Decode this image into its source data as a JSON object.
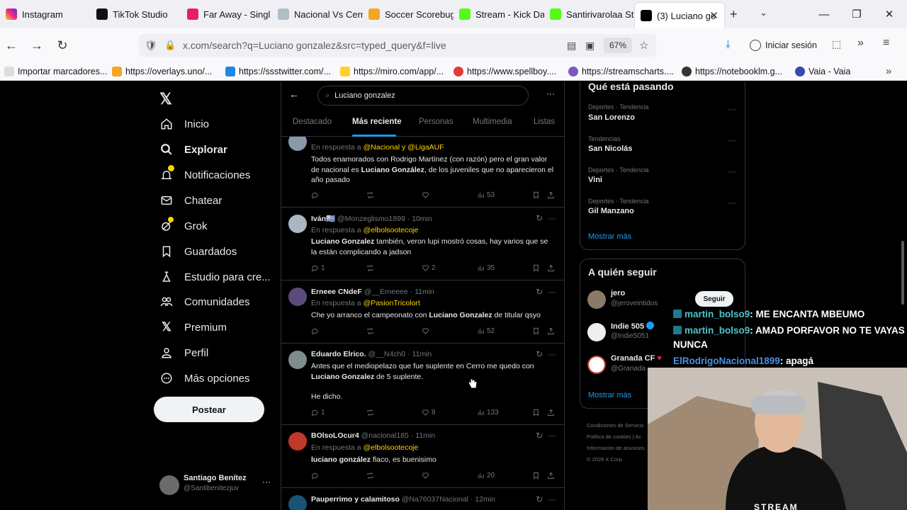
{
  "browser": {
    "tabs": [
      {
        "title": "Instagram",
        "color": "#d62976"
      },
      {
        "title": "TikTok Studio",
        "color": "#000000"
      },
      {
        "title": "Far Away - Singl",
        "color": "#e91e63"
      },
      {
        "title": "Nacional Vs Cerr",
        "color": "#b0bec5"
      },
      {
        "title": "Soccer Scorebug",
        "color": "#f5a623"
      },
      {
        "title": "Stream - Kick Da",
        "color": "#53fc18"
      },
      {
        "title": "Santirivarolaa St",
        "color": "#53fc18"
      },
      {
        "title": "(3) Luciano go",
        "color": "#000000"
      }
    ],
    "url": "x.com/search?q=Luciano gonzalez&src=typed_query&f=live",
    "zoom": "67%",
    "sign_in": "Iniciar sesión",
    "bookmarks": [
      "Importar marcadores...",
      "https://overlays.uno/...",
      "https://ssstwitter.com/...",
      "https://miro.com/app/...",
      "https://www.spellboy....",
      "https://streamscharts....",
      "https://notebooklm.g...",
      "Vaia - Vaia"
    ]
  },
  "nav": {
    "items": [
      "Inicio",
      "Explorar",
      "Notificaciones",
      "Chatear",
      "Grok",
      "Guardados",
      "Estudio para cre...",
      "Comunidades",
      "Premium",
      "Perfil",
      "Más opciones"
    ],
    "post_button": "Postear",
    "profile_name": "Santiago Benítez",
    "profile_handle": "@Santibenitezjuv"
  },
  "search": {
    "query": "Luciano gonzalez",
    "tabs": [
      "Destacado",
      "Más reciente",
      "Personas",
      "Multimedia",
      "Listas"
    ]
  },
  "tweets": [
    {
      "name": "",
      "meta": "",
      "reply_prefix": "En respuesta a",
      "mentions": "@Nacional y @LigaAUF",
      "text_a": "Todos enamorados con Rodrigo Martínez (con razón) pero el gran valor de nacional es ",
      "text_bold": "Luciano González",
      "text_b": ", de los juveniles que no aparecieron el año pasado",
      "replies": "",
      "retweets": "",
      "likes": "",
      "views": "53"
    },
    {
      "name": "Iván🇺🇾",
      "meta": "@Monzeglismo1899 · 10min",
      "reply_prefix": "En respuesta a",
      "mentions": "@elbolsootecoje",
      "text_a": "",
      "text_bold": "Luciano Gonzalez",
      "text_b": " también, veron lupi mostró cosas, hay varios que se la están complicando a jadson",
      "replies": "1",
      "retweets": "",
      "likes": "2",
      "views": "35"
    },
    {
      "name": "Erneee CNdeF",
      "meta": "@__Erneeee · 11min",
      "reply_prefix": "En respuesta a",
      "mentions": "@PasionTricolort",
      "text_a": "Che yo arranco el campeonato con ",
      "text_bold": "Luciano Gonzalez",
      "text_b": " de titular qsyo",
      "replies": "",
      "retweets": "",
      "likes": "",
      "views": "52"
    },
    {
      "name": "Eduardo Elrico.",
      "meta": "@__N4ch0 · 11min",
      "reply_prefix": "",
      "mentions": "",
      "text_a": "Antes que el mediopelazo que fue suplente en Cerro me quedo con ",
      "text_bold": "Luciano Gonzalez",
      "text_b": " de 5 suplente.",
      "text_c": "He dicho.",
      "replies": "1",
      "retweets": "",
      "likes": "8",
      "views": "133"
    },
    {
      "name": "BOlsoLOcur4",
      "meta": "@nacional185 · 11min",
      "reply_prefix": "En respuesta a",
      "mentions": "@elbolsootecoje",
      "text_a": "",
      "text_bold": "luciano gonzález",
      "text_b": " flaco, es buenisimo",
      "replies": "",
      "retweets": "",
      "likes": "",
      "views": "20"
    },
    {
      "name": "Pauperrimo y calamitoso",
      "meta": "@Na76037Nacional · 12min",
      "reply_prefix": "",
      "mentions": "",
      "text_a": "",
      "text_bold": "",
      "text_b": "",
      "replies": "",
      "retweets": "",
      "likes": "",
      "views": ""
    }
  ],
  "trends": {
    "title": "Qué está pasando",
    "items": [
      {
        "category": "Deportes · Tendencia",
        "name": "San Lorenzo"
      },
      {
        "category": "Tendencias",
        "name": "San Nicolás"
      },
      {
        "category": "Deportes · Tendencia",
        "name": "Vini"
      },
      {
        "category": "Deportes · Tendencia",
        "name": "Gil Manzano"
      }
    ],
    "show_more": "Mostrar más"
  },
  "who_to_follow": {
    "title": "A quién seguir",
    "items": [
      {
        "name": "jero",
        "handle": "@jeroveintidos",
        "button": "Seguir"
      },
      {
        "name": "Indie 505",
        "handle": "@Indie5051",
        "button": ""
      },
      {
        "name": "Granada CF",
        "handle": "@Granada",
        "button": ""
      }
    ],
    "show_more": "Mostrar más"
  },
  "footer": {
    "line1": "Condiciones de Servicio",
    "line2": "Política de cookies  |  Ac",
    "line3": "Información de anuncios",
    "line4": "© 2026 X Corp."
  },
  "stream_chat": [
    {
      "user": "martin_bolso9",
      "msg": ": ME ENCANTA MBEUMO"
    },
    {
      "user": "martin_bolso9",
      "msg": ": AMAD PORFAVOR NO TE VAYAS"
    },
    {
      "user": "",
      "msg": "NUNCA"
    },
    {
      "user": "ElRodrigoNacional1899",
      "msg": ": apagá"
    }
  ],
  "webcam_shirt": "STREAM"
}
